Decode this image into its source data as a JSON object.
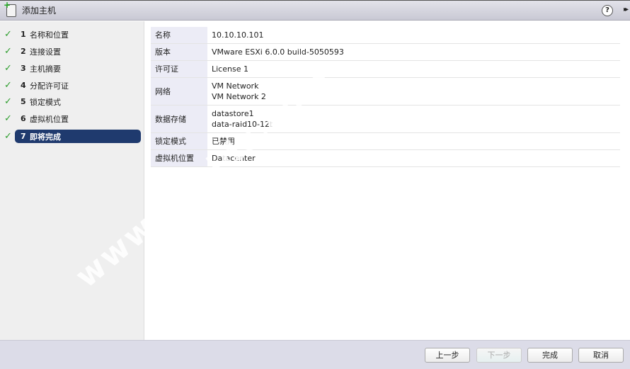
{
  "window": {
    "title": "添加主机",
    "help": "?",
    "more": "▸▸"
  },
  "steps": [
    {
      "num": "1",
      "label": "名称和位置",
      "done": true
    },
    {
      "num": "2",
      "label": "连接设置",
      "done": true
    },
    {
      "num": "3",
      "label": "主机摘要",
      "done": true
    },
    {
      "num": "4",
      "label": "分配许可证",
      "done": true
    },
    {
      "num": "5",
      "label": "锁定模式",
      "done": true
    },
    {
      "num": "6",
      "label": "虚拟机位置",
      "done": true
    },
    {
      "num": "7",
      "label": "即将完成",
      "done": true,
      "active": true
    }
  ],
  "check": "✓",
  "summary": [
    {
      "key": "名称",
      "values": [
        "10.10.10.101"
      ]
    },
    {
      "key": "版本",
      "values": [
        "VMware ESXi 6.0.0 build-5050593"
      ]
    },
    {
      "key": "许可证",
      "values": [
        "License 1"
      ]
    },
    {
      "key": "网络",
      "values": [
        "VM Network",
        "VM Network 2"
      ]
    },
    {
      "key": "数据存储",
      "values": [
        "datastore1",
        "data-raid10-12t"
      ]
    },
    {
      "key": "锁定模式",
      "values": [
        "已禁用"
      ]
    },
    {
      "key": "虚拟机位置",
      "values": [
        "Datacenter"
      ]
    }
  ],
  "buttons": {
    "back": "上一步",
    "next": "下一步",
    "finish": "完成",
    "cancel": "取消"
  },
  "watermark": "www.vpsidc.com"
}
